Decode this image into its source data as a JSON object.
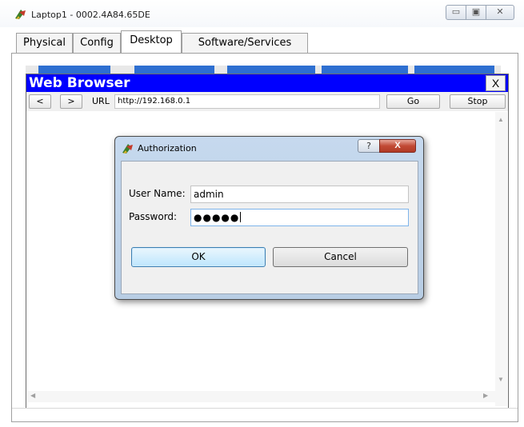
{
  "window": {
    "title": "Laptop1 - 0002.4A84.65DE",
    "controls": {
      "minimize": "▭",
      "maximize": "▣",
      "close": "✕"
    }
  },
  "tabs": [
    {
      "label": "Physical"
    },
    {
      "label": "Config"
    },
    {
      "label": "Desktop",
      "active": true
    },
    {
      "label": "Software/Services"
    }
  ],
  "browser": {
    "title": "Web Browser",
    "close_label": "X",
    "back_label": "<",
    "forward_label": ">",
    "url_label": "URL",
    "url_value": "http://192.168.0.1",
    "go_label": "Go",
    "stop_label": "Stop"
  },
  "dialog": {
    "title": "Authorization",
    "help_label": "?",
    "close_label": "X",
    "username_label": "User Name:",
    "username_value": "admin",
    "password_label": "Password:",
    "password_value": "●●●●●",
    "ok_label": "OK",
    "cancel_label": "Cancel"
  },
  "colors": {
    "browser_title_bg": "#0000ff",
    "dialog_frame": "#c6d9ee",
    "close_button": "#c14a35"
  },
  "icons": {
    "app_icon": "packet-tracer-icon",
    "dialog_icon": "packet-tracer-icon"
  }
}
